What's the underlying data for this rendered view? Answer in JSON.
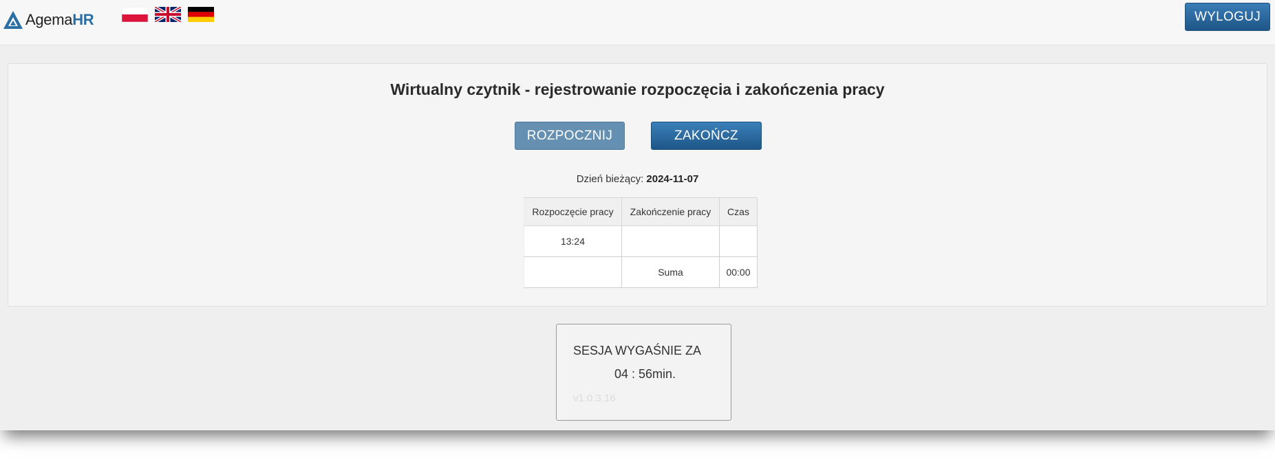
{
  "header": {
    "logo_text_main": "Agema",
    "logo_text_accent": "HR",
    "flags": [
      {
        "icon": "flag-poland-icon"
      },
      {
        "icon": "flag-uk-icon"
      },
      {
        "icon": "flag-germany-icon"
      }
    ],
    "logout_label": "WYLOGUJ"
  },
  "main": {
    "title": "Wirtualny czytnik - rejestrowanie rozpoczęcia i zakończenia pracy",
    "start_label": "ROZPOCZNIJ",
    "end_label": "ZAKOŃCZ",
    "date_label": "Dzień bieżący:",
    "date_value": "2024-11-07",
    "table": {
      "headers": [
        "Rozpoczęcie pracy",
        "Zakończenie pracy",
        "Czas"
      ],
      "rows": [
        [
          "13:24",
          "",
          ""
        ]
      ],
      "sum_label": "Suma",
      "sum_value": "00:00"
    }
  },
  "session": {
    "label": "SESJA WYGAŚNIE ZA",
    "time": "04 : 56min.",
    "version": "v1.0.3.16"
  },
  "colors": {
    "brand": "#2b6ea3",
    "button_primary": "#1e5687",
    "button_disabled": "#6590b2",
    "background": "#efefef"
  }
}
